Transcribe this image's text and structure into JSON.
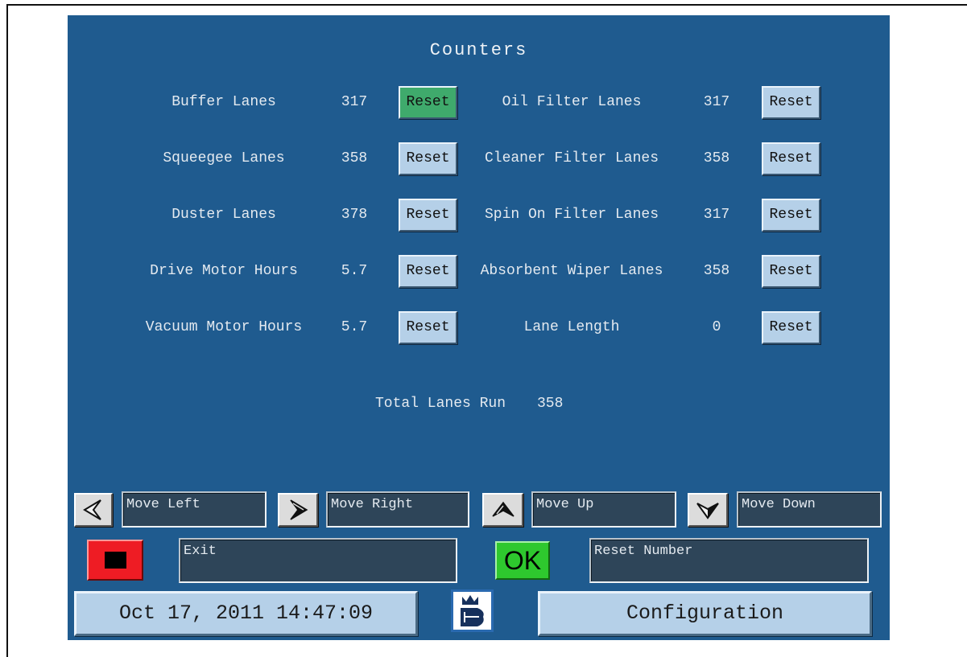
{
  "screen": {
    "title": "Counters"
  },
  "counters": {
    "left": [
      {
        "label": "Buffer Lanes",
        "value": "317",
        "reset": {
          "label": "Reset",
          "highlighted": true
        }
      },
      {
        "label": "Squeegee Lanes",
        "value": "358",
        "reset": {
          "label": "Reset",
          "highlighted": false
        }
      },
      {
        "label": "Duster Lanes",
        "value": "378",
        "reset": {
          "label": "Reset",
          "highlighted": false
        }
      },
      {
        "label": "Drive Motor Hours",
        "value": "5.7",
        "reset": {
          "label": "Reset",
          "highlighted": false
        }
      },
      {
        "label": "Vacuum Motor Hours",
        "value": "5.7",
        "reset": {
          "label": "Reset",
          "highlighted": false
        }
      }
    ],
    "right": [
      {
        "label": "Oil Filter Lanes",
        "value": "317",
        "reset": {
          "label": "Reset",
          "highlighted": false
        }
      },
      {
        "label": "Cleaner Filter Lanes",
        "value": "358",
        "reset": {
          "label": "Reset",
          "highlighted": false
        }
      },
      {
        "label": "Spin On Filter Lanes",
        "value": "317",
        "reset": {
          "label": "Reset",
          "highlighted": false
        }
      },
      {
        "label": "Absorbent Wiper Lanes",
        "value": "358",
        "reset": {
          "label": "Reset",
          "highlighted": false
        }
      },
      {
        "label": "Lane Length",
        "value": "0",
        "reset": {
          "label": "Reset",
          "highlighted": false
        }
      }
    ]
  },
  "total": {
    "label": "Total Lanes Run",
    "value": "358"
  },
  "navigation": [
    {
      "icon": "arrow-left-icon",
      "label": "Move Left"
    },
    {
      "icon": "arrow-right-icon",
      "label": "Move Right"
    },
    {
      "icon": "arrow-up-icon",
      "label": "Move Up"
    },
    {
      "icon": "arrow-down-icon",
      "label": "Move Down"
    }
  ],
  "actions": {
    "stop_icon": "stop-icon",
    "exit_label": "Exit",
    "ok_label": "OK",
    "reset_number_label": "Reset Number"
  },
  "footer": {
    "datetime": "Oct 17, 2011 14:47:09",
    "logo_icon": "bowling-crown-logo-icon",
    "configuration_label": "Configuration"
  },
  "colors": {
    "panel": "#1f5b8f",
    "reset_button": "#b5d0e8",
    "reset_highlight": "#3faa6c",
    "field": "#2e4559",
    "stop_button": "#ee1c24",
    "ok_button": "#2ec82e"
  }
}
